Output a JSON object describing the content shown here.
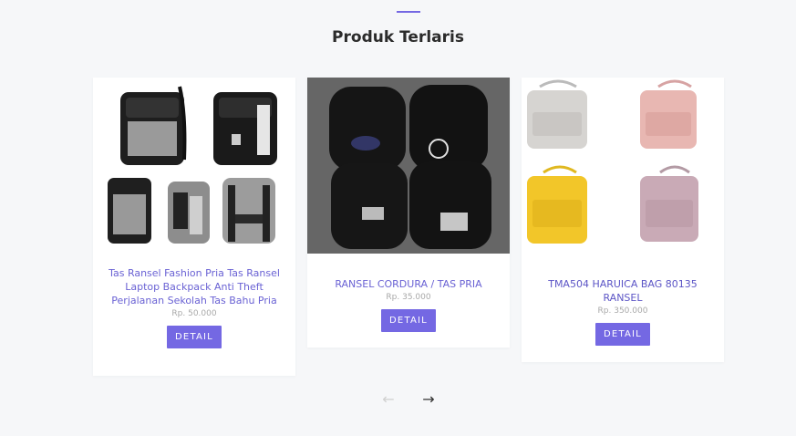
{
  "section": {
    "title": "Produk Terlaris"
  },
  "products": [
    {
      "name": "Tas Ransel Fashion Pria Tas Ransel Laptop Backpack Anti Theft Perjalanan Sekolah Tas Bahu Pria",
      "price": "Rp. 50.000",
      "button": "DETAIL"
    },
    {
      "name": "RANSEL CORDURA / TAS PRIA",
      "price": "Rp. 35.000",
      "button": "DETAIL"
    },
    {
      "name": "TMA504 HARUICA BAG 80135 RANSEL",
      "price": "Rp. 350.000",
      "button": "DETAIL"
    }
  ],
  "navigation": {
    "prev_icon": "←",
    "next_icon": "→"
  },
  "colors": {
    "accent": "#7468e3",
    "background": "#f6f7f9"
  },
  "icons": {
    "prev": "arrow-left-icon",
    "next": "arrow-right-icon"
  }
}
